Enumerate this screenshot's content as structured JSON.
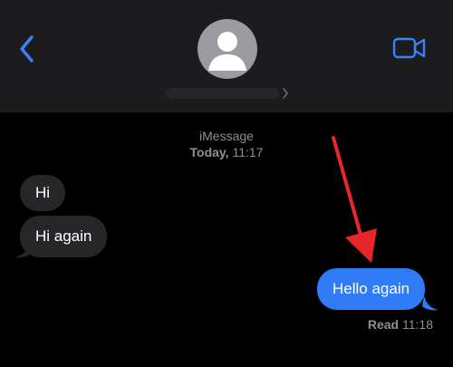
{
  "header": {
    "back_icon": "chevron-left-icon",
    "avatar_icon": "person-silhouette-icon",
    "facetime_icon": "video-camera-icon",
    "disclosure_icon": "chevron-right-icon"
  },
  "conversation": {
    "service": "iMessage",
    "day": "Today,",
    "time": "11:17",
    "messages": [
      {
        "direction": "incoming",
        "text": "Hi"
      },
      {
        "direction": "incoming",
        "text": "Hi again"
      },
      {
        "direction": "outgoing",
        "text": "Hello again"
      }
    ],
    "receipt": {
      "status": "Read",
      "time": "11:18"
    }
  },
  "colors": {
    "header_bg": "#1c1c1e",
    "accent_blue": "#2f7cf6",
    "incoming_bubble": "#262628",
    "annotation_red": "#e5262b"
  }
}
